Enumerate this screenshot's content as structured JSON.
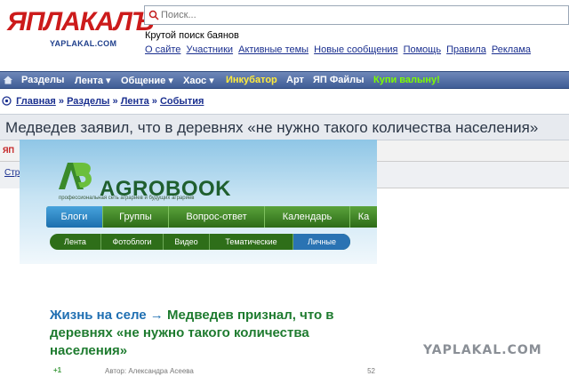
{
  "header": {
    "logo_main": "ЯПЛАКАЛЪ",
    "logo_sub": "YAPLAKAL.COM",
    "search_placeholder": "Поиск...",
    "tagline": "Крутой поиск баянов",
    "links": [
      "О сайте",
      "Участники",
      "Активные темы",
      "Новые сообщения",
      "Помощь",
      "Правила",
      "Реклама"
    ]
  },
  "nav": {
    "items": [
      {
        "label": "Разделы",
        "color": "#ffffff"
      },
      {
        "label": "Лента ▾",
        "color": "#ffffff"
      },
      {
        "label": "Общение ▾",
        "color": "#ffffff"
      },
      {
        "label": "Хаос ▾",
        "color": "#ffffff"
      },
      {
        "label": "Инкубатор",
        "color": "#ffeb3b"
      },
      {
        "label": "Арт",
        "color": "#ffffff"
      },
      {
        "label": "ЯП Файлы",
        "color": "#ffffff"
      },
      {
        "label": "Купи валыну!",
        "color": "#7CFC00"
      }
    ]
  },
  "breadcrumb": [
    "Главная",
    "Разделы",
    "Лента",
    "События"
  ],
  "topic": {
    "title": "Медведев заявил, что в деревнях «не нужно такого количества населения»",
    "sub_logo": "ЯП",
    "sub_link": "Стр"
  },
  "embed": {
    "brand": "AGROBOOK",
    "tagline": "профессиональная сеть аграриев и будущих аграриев",
    "tabs": [
      "Блоги",
      "Группы",
      "Вопрос-ответ",
      "Календарь",
      "Ка"
    ],
    "active_tab": "Блоги",
    "subtabs": [
      "Лента",
      "Фотоблоги",
      "Видео",
      "Тематические",
      "Личные"
    ],
    "active_subtab": "Личные",
    "article_section": "Жизнь на селе",
    "article_arrow": "→",
    "article_title": "Медведев признал, что в деревнях «не нужно такого количества населения»",
    "vote": "+1",
    "author": "Автор: Александра Асеева",
    "num": "52"
  },
  "watermark": "YAPLAKAL.COM",
  "colors": {
    "nav_bg": "#4a66a0",
    "link": "#1a2f8f",
    "logo_red": "#cc1b1b",
    "agro_green": "#2d6b17",
    "agro_blue": "#1c6fae",
    "article_green": "#1e7b2f"
  }
}
